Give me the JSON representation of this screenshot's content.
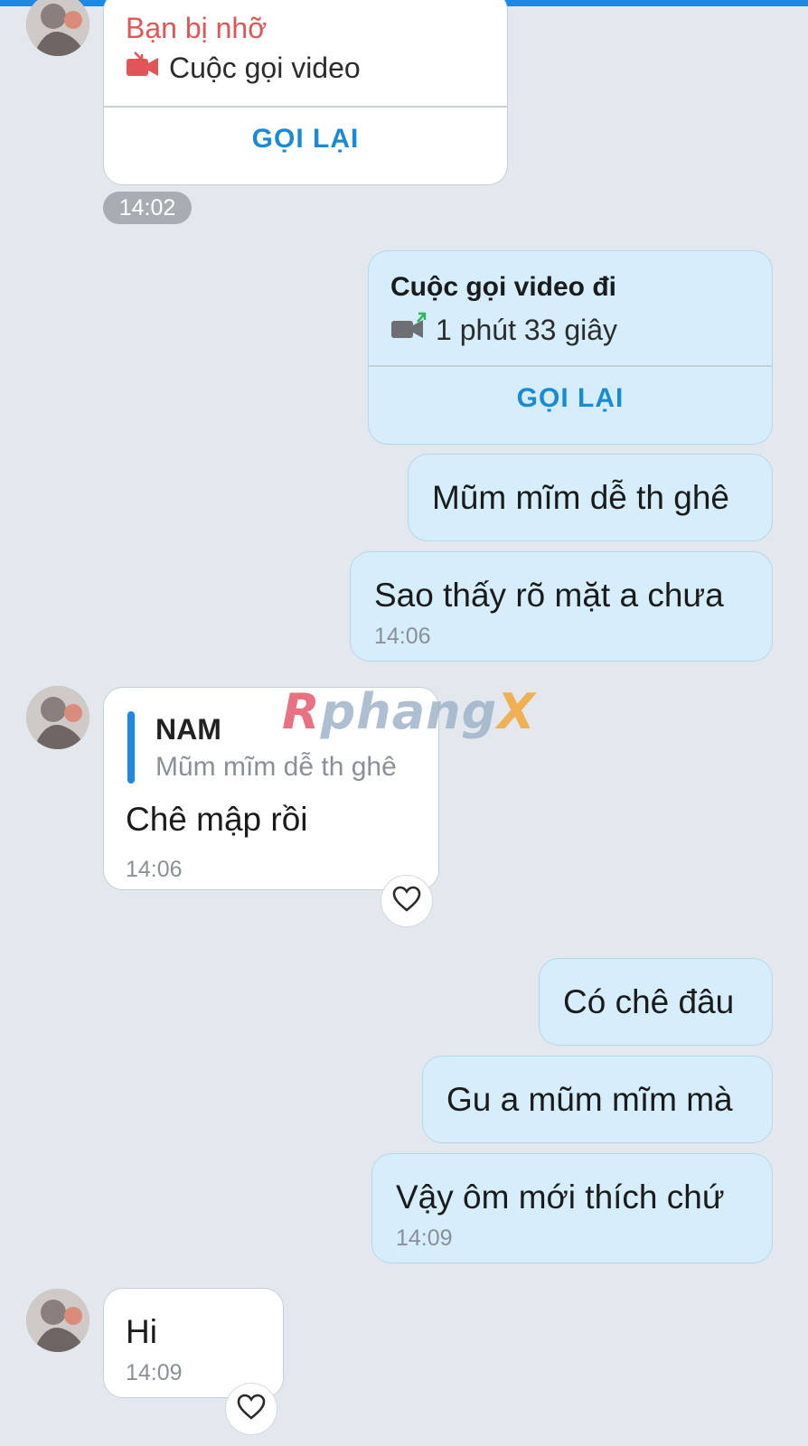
{
  "messages": {
    "missed_call": {
      "title": "Bạn bị nhỡ",
      "type": "Cuộc gọi video",
      "action": "GỌI LẠI",
      "time": "14:02"
    },
    "outgoing_call": {
      "title": "Cuộc gọi video đi",
      "duration": "1 phút 33 giây",
      "action": "GỌI LẠI"
    },
    "out1": {
      "text": "Mũm mĩm dễ th ghê"
    },
    "out2": {
      "text": "Sao thấy rõ mặt a chưa",
      "time": "14:06"
    },
    "in1": {
      "quote_author": "NAM",
      "quote_text": "Mũm mĩm dễ th ghê",
      "text": "Chê mập rồi",
      "time": "14:06"
    },
    "out3": {
      "text": "Có chê đâu"
    },
    "out4": {
      "text": "Gu a mũm mĩm mà"
    },
    "out5": {
      "text": "Vậy ôm mới thích chứ",
      "time": "14:09"
    },
    "in2": {
      "text": "Hi",
      "time": "14:09"
    }
  },
  "watermark": {
    "part1": "R",
    "part2": "phang",
    "part3": "X"
  },
  "icons": {
    "missed": "missed-video-call-icon",
    "outgoing": "outgoing-video-call-icon",
    "reaction": "heart-icon"
  },
  "colors": {
    "background": "#e3e8ef",
    "incoming": "#ffffff",
    "outgoing": "#d6edfc",
    "accent": "#1a8ad4",
    "missed": "#e05555",
    "outgoing_arrow": "#2eb85c"
  }
}
